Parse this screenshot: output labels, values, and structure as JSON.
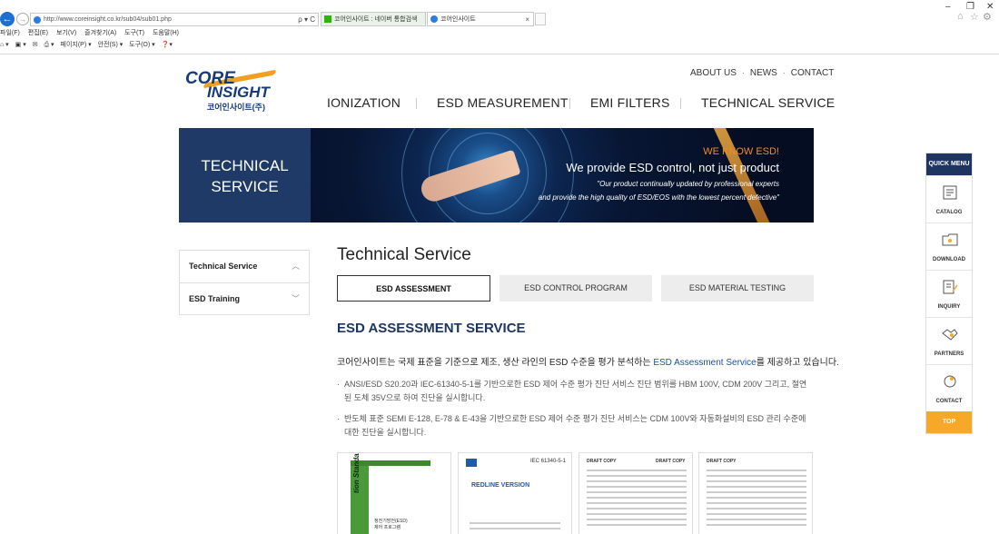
{
  "browser": {
    "url": "http://www.coreinsight.co.kr/sub04/sub01.php",
    "address_controls": "ρ ▾ C",
    "tabs": [
      {
        "label": "코어인사이트 : 네이버 통합검색"
      },
      {
        "label": "코어인사이트"
      }
    ],
    "tab_close": "×",
    "menubar": [
      "파일(F)",
      "편집(E)",
      "보기(V)",
      "즐겨찾기(A)",
      "도구(T)",
      "도움말(H)"
    ],
    "cmdbar": [
      "페이지(P) ▾",
      "안전(S) ▾",
      "도구(O) ▾"
    ],
    "window_controls": {
      "minimize": "–",
      "restore": "❐",
      "close": "✕"
    },
    "toolbar_icons": {
      "home": "⌂",
      "favorites": "☆",
      "settings": "⚙"
    }
  },
  "site": {
    "logo": {
      "line1": "CORE",
      "line2": "INSIGHT",
      "korean": "코어인사이트(주)"
    },
    "top_links": [
      "ABOUT US",
      "NEWS",
      "CONTACT"
    ],
    "top_link_sep": "·",
    "gnb": [
      "IONIZATION",
      "ESD MEASUREMENT",
      "EMI FILTERS",
      "TECHNICAL SERVICE"
    ]
  },
  "banner": {
    "title_line1": "TECHNICAL",
    "title_line2": "SERVICE",
    "tagline": "WE KNOW ESD!",
    "headline": "We provide ESD control, not just product",
    "quote1": "\"Our product continually updated by professional experts",
    "quote2": "and provide the high quality of ESD/EOS with the lowest percent defective\""
  },
  "sidebar": {
    "items": [
      {
        "label": "Technical Service",
        "chevron": "︿"
      },
      {
        "label": "ESD Training",
        "chevron": "﹀"
      }
    ]
  },
  "content": {
    "page_title": "Technical Service",
    "tabs": [
      "ESD ASSESSMENT",
      "ESD CONTROL PROGRAM",
      "ESD MATERIAL TESTING"
    ],
    "active_tab": 0,
    "section_title": "ESD ASSESSMENT SERVICE",
    "intro_before": "코어인사이트는 국제 표준을 기준으로 제조, 생산 라인의 ESD 수준을 평가 분석하는 ",
    "intro_highlight": "ESD Assessment Service",
    "intro_after": "를 제공하고 있습니다.",
    "bullets": [
      "ANSI/ESD S20.20과 IEC-61340-5-1를 기반으로한 ESD 제어 수준 평가 진단 서비스 진단 범위를 HBM 100V, CDM 200V 그리고, 절연된 도체 35V으로 하여 진단을 실시합니다.",
      "반도체 표준 SEMI E-128, E-78 & E-43을 기반으로한 ESD 제어 수준 평가 진단 서비스는 CDM 100V와 자동화설비의 ESD 관리 수준에 대한 진단을 실시합니다."
    ],
    "documents": [
      {
        "cover_text": "tion Standard",
        "korean_title": "정전기방전(ESD)\n제어 프로그램"
      },
      {
        "code": "IEC 61340-5-1",
        "title": "REDLINE VERSION"
      },
      {
        "draft_left": "DRAFT COPY",
        "draft_right": "DRAFT COPY"
      },
      {
        "draft_left": "DRAFT COPY"
      }
    ]
  },
  "quick_menu": {
    "title": "QUICK MENU",
    "items": [
      {
        "label": "CATALOG",
        "icon": "catalog-icon"
      },
      {
        "label": "DOWNLOAD",
        "icon": "folder-icon"
      },
      {
        "label": "INQUIRY",
        "icon": "pencil-doc-icon"
      },
      {
        "label": "PARTNERS",
        "icon": "handshake-icon"
      },
      {
        "label": "CONTACT",
        "icon": "phone-icon"
      }
    ],
    "top_label": "TOP"
  },
  "colors": {
    "navy": "#1d3560",
    "accent_orange": "#f6a828",
    "link_blue": "#1d4fa0"
  }
}
